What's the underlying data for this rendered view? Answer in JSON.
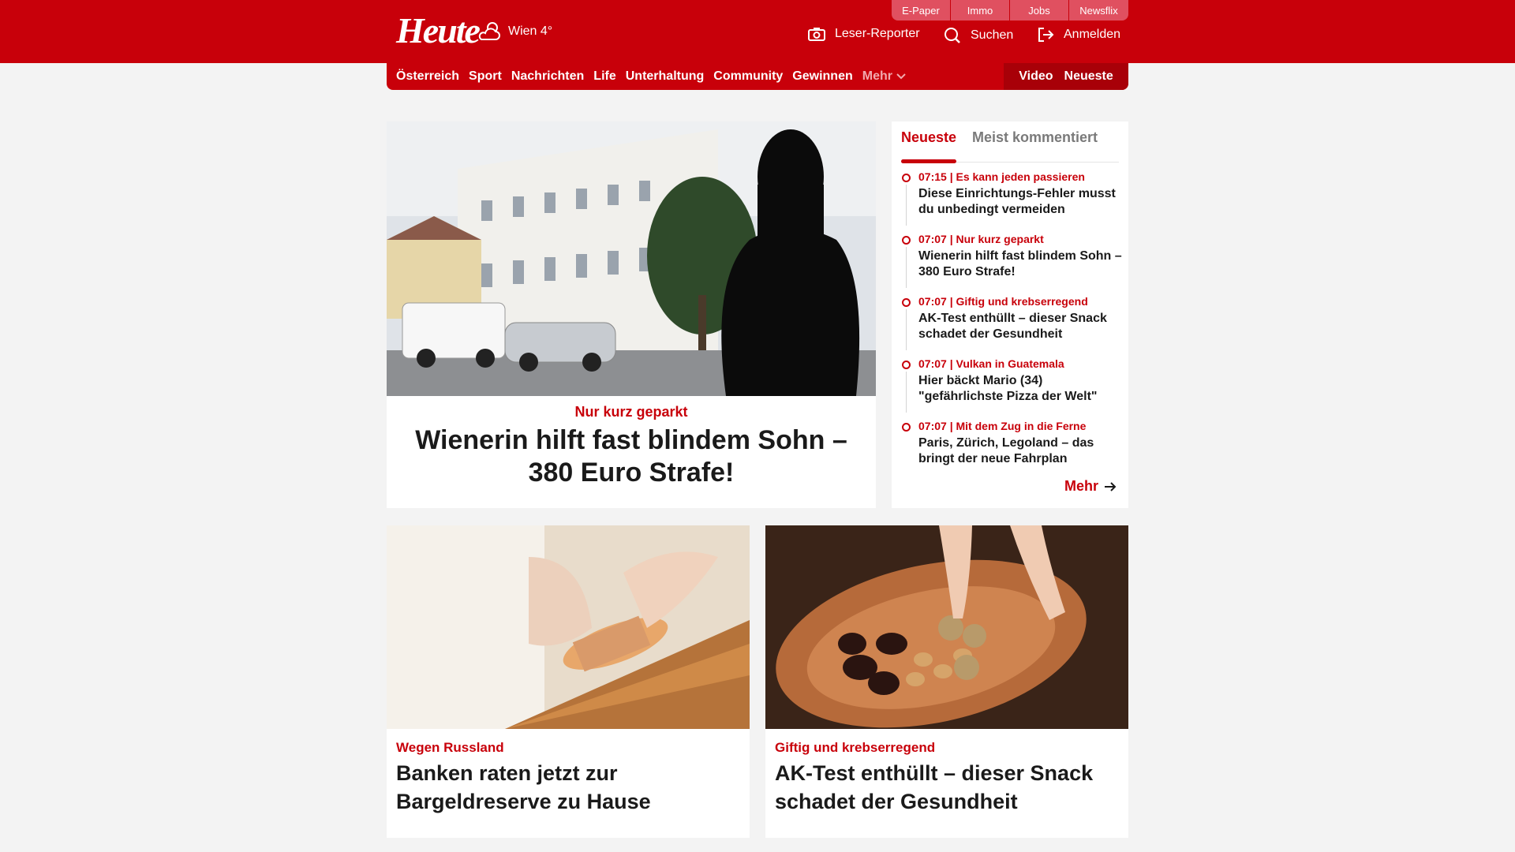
{
  "header": {
    "logo": "Heute",
    "weather": "Wien 4°",
    "top_links": [
      "E-Paper",
      "Immo",
      "Jobs",
      "Newsflix"
    ],
    "leser_reporter": "Leser-Reporter",
    "suchen": "Suchen",
    "anmelden": "Anmelden"
  },
  "nav": {
    "items": [
      "Österreich",
      "Sport",
      "Nachrichten",
      "Life",
      "Unterhaltung",
      "Community",
      "Gewinnen"
    ],
    "more": "Mehr",
    "video": "Video",
    "neueste": "Neueste"
  },
  "hero": {
    "kicker": "Nur kurz geparkt",
    "title": "Wienerin hilft fast blindem Sohn – 380 Euro Strafe!"
  },
  "sidebar": {
    "tabs": [
      "Neueste",
      "Meist kommentiert"
    ],
    "items": [
      {
        "meta": "07:15 | Es kann jeden passieren",
        "title": "Diese Einrichtungs-Fehler musst du unbedingt vermeiden"
      },
      {
        "meta": "07:07 | Nur kurz geparkt",
        "title": "Wienerin hilft fast blindem Sohn – 380 Euro Strafe!"
      },
      {
        "meta": "07:07 | Giftig und krebserregend",
        "title": "AK-Test enthüllt – dieser Snack schadet der Gesundheit"
      },
      {
        "meta": "07:07 | Vulkan in Guatemala",
        "title": "Hier bäckt Mario (34) \"gefährlichste Pizza der Welt\""
      },
      {
        "meta": "07:07 | Mit dem Zug in die Ferne",
        "title": "Paris, Zürich, Legoland – das bringt der neue Fahrplan"
      }
    ],
    "more": "Mehr"
  },
  "cards": [
    {
      "kicker": "Wegen Russland",
      "title": "Banken raten jetzt zur Bargeldreserve zu Hause"
    },
    {
      "kicker": "Giftig und krebserregend",
      "title": "AK-Test enthüllt – dieser Snack schadet der Gesundheit"
    }
  ],
  "colors": {
    "brand_red": "#c8000a",
    "background": "#f3f3f3"
  }
}
